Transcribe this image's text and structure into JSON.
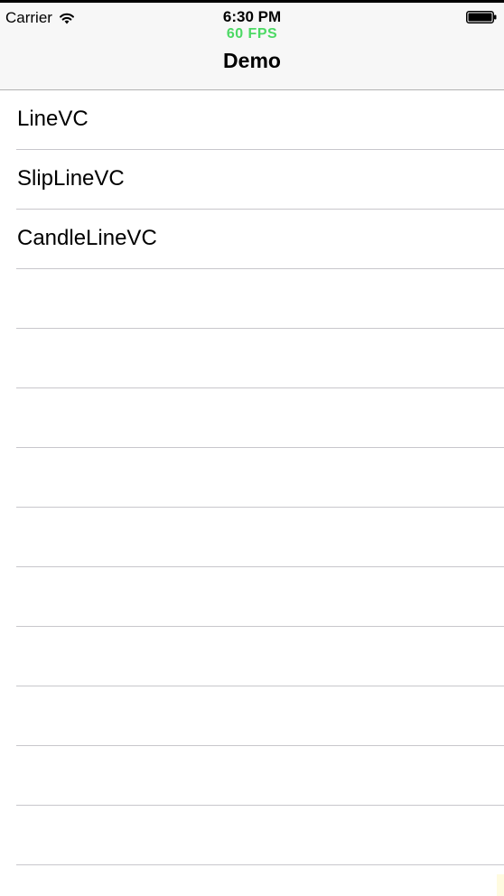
{
  "status_bar": {
    "carrier": "Carrier",
    "time": "6:30 PM",
    "fps": "60 FPS",
    "wifi_icon": "wifi-icon",
    "battery_icon": "battery-icon"
  },
  "nav": {
    "title": "Demo"
  },
  "list": {
    "items": [
      {
        "label": "LineVC"
      },
      {
        "label": "SlipLineVC"
      },
      {
        "label": "CandleLineVC"
      },
      {
        "label": ""
      },
      {
        "label": ""
      },
      {
        "label": ""
      },
      {
        "label": ""
      },
      {
        "label": ""
      },
      {
        "label": ""
      },
      {
        "label": ""
      },
      {
        "label": ""
      },
      {
        "label": ""
      },
      {
        "label": ""
      }
    ]
  },
  "colors": {
    "fps_green": "#4cd964",
    "navbar_bg": "#f7f7f7",
    "separator": "#c8c7cc"
  }
}
